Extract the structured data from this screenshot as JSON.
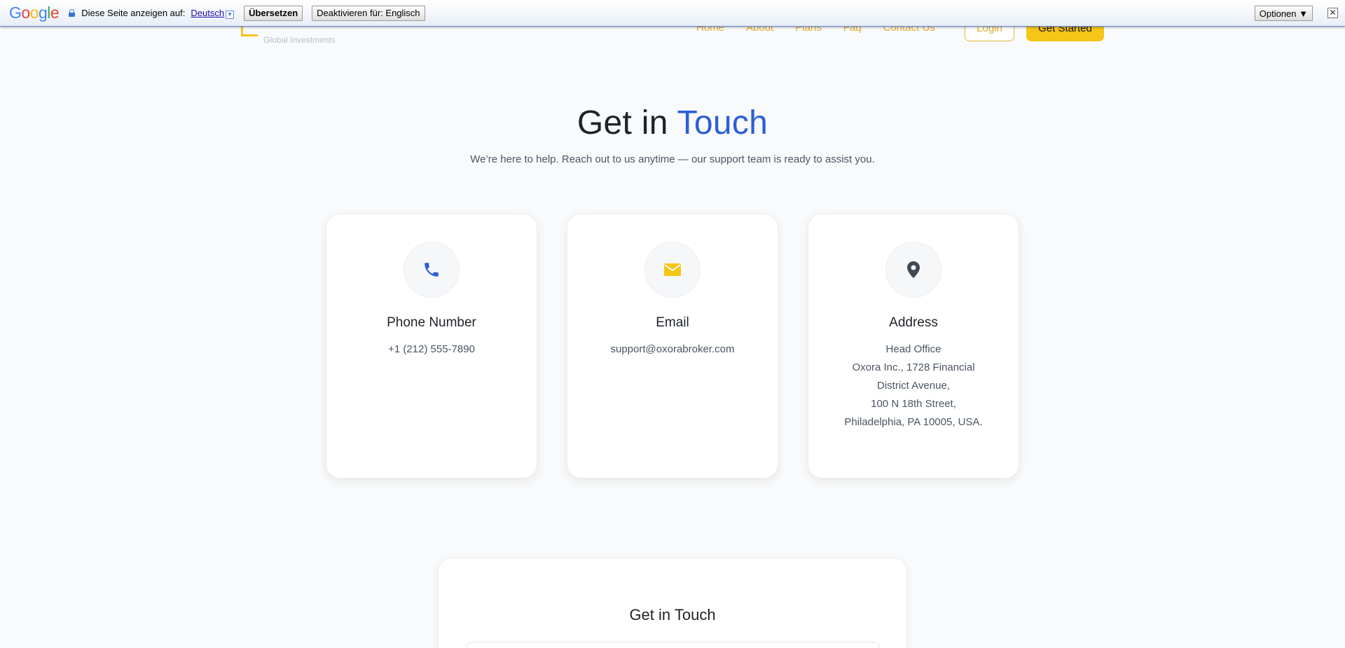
{
  "translate_bar": {
    "logo": "Google",
    "prompt_text": "Diese Seite anzeigen auf:",
    "language": "Deutsch",
    "translate_button": "Übersetzen",
    "disable_button": "Deaktivieren für: Englisch",
    "options_button": "Optionen ▼",
    "close_label": "✕"
  },
  "nav": {
    "brand_tagline": "Global Investments",
    "links": [
      "Home",
      "About",
      "Plans",
      "Faq",
      "Contact Us"
    ],
    "login_label": "Login",
    "get_started_label": "Get Started"
  },
  "hero": {
    "title_prefix": "Get in",
    "title_accent": "Touch",
    "subtitle": "We’re here to help. Reach out to us anytime — our support team is ready to assist you."
  },
  "cards": [
    {
      "icon": "phone-icon",
      "title": "Phone Number",
      "lines": [
        "+1 (212) 555-7890"
      ]
    },
    {
      "icon": "envelope-icon",
      "title": "Email",
      "lines": [
        "support@oxorabroker.com"
      ]
    },
    {
      "icon": "map-pin-icon",
      "title": "Address",
      "lines": [
        "Head Office",
        "Oxora Inc., 1728 Financial",
        "District Avenue,",
        "100 N 18th Street,",
        "Philadelphia, PA 10005, USA."
      ]
    }
  ],
  "form": {
    "title": "Get in Touch"
  },
  "colors": {
    "accent_blue": "#2c5fd6",
    "accent_yellow": "#f5c518",
    "nav_link": "#e2a92a"
  }
}
